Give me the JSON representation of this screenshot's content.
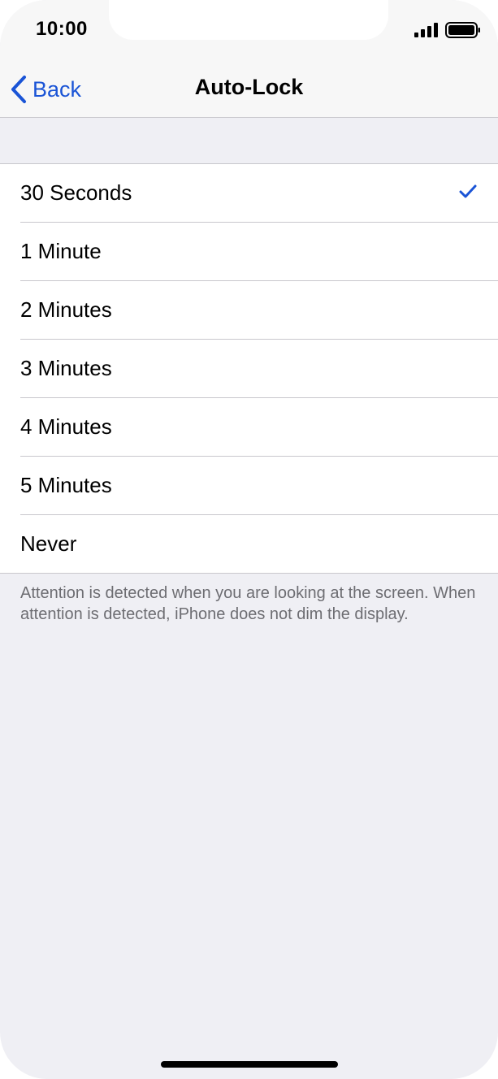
{
  "status_bar": {
    "time": "10:00",
    "signal_icon": "cellular-signal-icon",
    "battery_icon": "battery-full-icon"
  },
  "nav": {
    "back_label": "Back",
    "back_icon": "chevron-left-icon",
    "title": "Auto-Lock"
  },
  "options": [
    {
      "label": "30 Seconds",
      "selected": true
    },
    {
      "label": "1 Minute",
      "selected": false
    },
    {
      "label": "2 Minutes",
      "selected": false
    },
    {
      "label": "3 Minutes",
      "selected": false
    },
    {
      "label": "4 Minutes",
      "selected": false
    },
    {
      "label": "5 Minutes",
      "selected": false
    },
    {
      "label": "Never",
      "selected": false
    }
  ],
  "footnote": "Attention is detected when you are looking at the screen. When attention is detected, iPhone does not dim the display.",
  "colors": {
    "accent": "#1a54d6",
    "background": "#efeff4",
    "separator": "#c8c7cc",
    "footnote": "#6d6d72"
  }
}
